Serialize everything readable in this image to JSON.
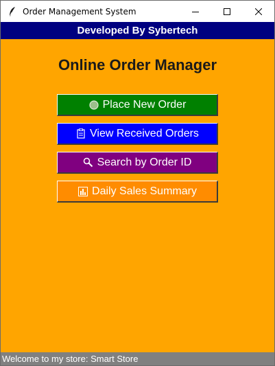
{
  "window": {
    "title": "Order Management System",
    "icon": "feather-icon"
  },
  "banner": {
    "text": "Developed By Sybertech"
  },
  "main": {
    "title": "Online Order Manager"
  },
  "buttons": [
    {
      "label": "Place New Order",
      "icon": "circle-icon",
      "color": "#008000"
    },
    {
      "label": "View Received Orders",
      "icon": "clipboard-icon",
      "color": "#0000ff"
    },
    {
      "label": "Search by Order ID",
      "icon": "magnifier-icon",
      "color": "#800080"
    },
    {
      "label": "Daily Sales Summary",
      "icon": "bar-chart-icon",
      "color": "#ff8c00"
    }
  ],
  "status": {
    "text": "Welcome to my store: Smart Store"
  },
  "colors": {
    "background": "#ffa500",
    "banner": "#000080",
    "status_bar": "#808080"
  }
}
